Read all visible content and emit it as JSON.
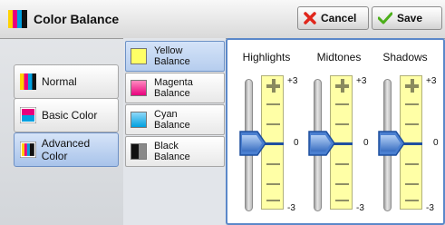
{
  "header": {
    "title": "Color Balance",
    "cancel_label": "Cancel",
    "save_label": "Save"
  },
  "presets": [
    {
      "label": "Normal",
      "selected": false
    },
    {
      "label": "Basic Color",
      "selected": false
    },
    {
      "label": "Advanced Color",
      "selected": true
    }
  ],
  "colors": [
    {
      "label_line1": "Yellow",
      "label_line2": "Balance",
      "swatch": "#ffff66",
      "selected": true
    },
    {
      "label_line1": "Magenta",
      "label_line2": "Balance",
      "swatch": "#ff5fa0",
      "selected": false
    },
    {
      "label_line1": "Cyan",
      "label_line2": "Balance",
      "swatch": "#3fb4ea",
      "selected": false
    },
    {
      "label_line1": "Black",
      "label_line2": "Balance",
      "swatch": "#333333",
      "selected": false
    }
  ],
  "sliders": [
    {
      "label": "Highlights",
      "max_label": "+3",
      "mid_label": "0",
      "min_label": "-3",
      "value": 0
    },
    {
      "label": "Midtones",
      "max_label": "+3",
      "mid_label": "0",
      "min_label": "-3",
      "value": 0
    },
    {
      "label": "Shadows",
      "max_label": "+3",
      "mid_label": "0",
      "min_label": "-3",
      "value": 0
    }
  ],
  "colors_theme": {
    "accent": "#5b88c9",
    "bar_fill": "#ffffa6",
    "indicator": "#1f4fa0"
  }
}
